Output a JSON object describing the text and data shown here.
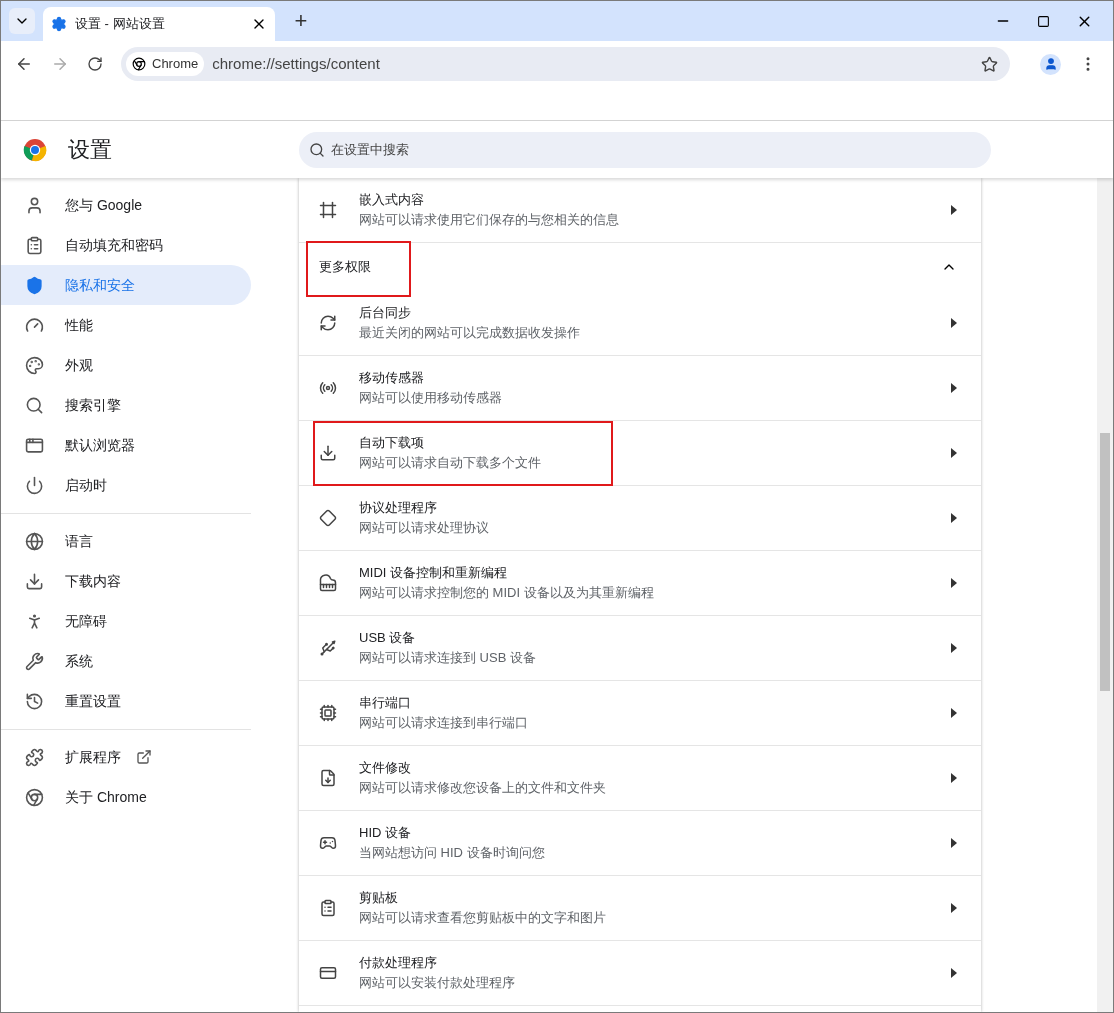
{
  "tab_strip": {
    "tabs": [
      {
        "title": "设置 - 网站设置",
        "selected": true
      }
    ],
    "new_tab": "+"
  },
  "toolbar": {
    "site_chip": "Chrome",
    "url": "chrome://settings/content"
  },
  "header": {
    "title": "设置",
    "search": {
      "placeholder": "在设置中搜索"
    }
  },
  "sidebar": {
    "groups": [
      [
        {
          "label": "您与 Google",
          "selected": false
        },
        {
          "label": "自动填充和密码",
          "selected": false
        },
        {
          "label": "隐私和安全",
          "selected": true
        },
        {
          "label": "性能",
          "selected": false
        },
        {
          "label": "外观",
          "selected": false
        },
        {
          "label": "搜索引擎",
          "selected": false
        },
        {
          "label": "默认浏览器",
          "selected": false
        },
        {
          "label": "启动时",
          "selected": false
        }
      ],
      [
        {
          "label": "语言",
          "selected": false
        },
        {
          "label": "下载内容",
          "selected": false
        },
        {
          "label": "无障碍",
          "selected": false
        },
        {
          "label": "系统",
          "selected": false
        },
        {
          "label": "重置设置",
          "selected": false
        }
      ],
      [
        {
          "label": "扩展程序",
          "selected": false,
          "external": true
        },
        {
          "label": "关于 Chrome",
          "selected": false,
          "external": false
        }
      ]
    ]
  },
  "content": {
    "rows_before": [
      {
        "title": "嵌入式内容",
        "subtitle": "网站可以请求使用它们保存的与您相关的信息",
        "highlighted": false
      }
    ],
    "section": {
      "title": "更多权限",
      "expanded": true,
      "highlighted": true
    },
    "rows": [
      {
        "title": "后台同步",
        "subtitle": "最近关闭的网站可以完成数据收发操作",
        "highlighted": false
      },
      {
        "title": "移动传感器",
        "subtitle": "网站可以使用移动传感器",
        "highlighted": false
      },
      {
        "title": "自动下载项",
        "subtitle": "网站可以请求自动下载多个文件",
        "highlighted": true
      },
      {
        "title": "协议处理程序",
        "subtitle": "网站可以请求处理协议",
        "highlighted": false
      },
      {
        "title": "MIDI 设备控制和重新编程",
        "subtitle": "网站可以请求控制您的 MIDI 设备以及为其重新编程",
        "highlighted": false
      },
      {
        "title": "USB 设备",
        "subtitle": "网站可以请求连接到 USB 设备",
        "highlighted": false
      },
      {
        "title": "串行端口",
        "subtitle": "网站可以请求连接到串行端口",
        "highlighted": false
      },
      {
        "title": "文件修改",
        "subtitle": "网站可以请求修改您设备上的文件和文件夹",
        "highlighted": false
      },
      {
        "title": "HID 设备",
        "subtitle": "当网站想访问 HID 设备时询问您",
        "highlighted": false
      },
      {
        "title": "剪贴板",
        "subtitle": "网站可以请求查看您剪贴板中的文字和图片",
        "highlighted": false
      },
      {
        "title": "付款处理程序",
        "subtitle": "网站可以安装付款处理程序",
        "highlighted": false
      }
    ]
  }
}
